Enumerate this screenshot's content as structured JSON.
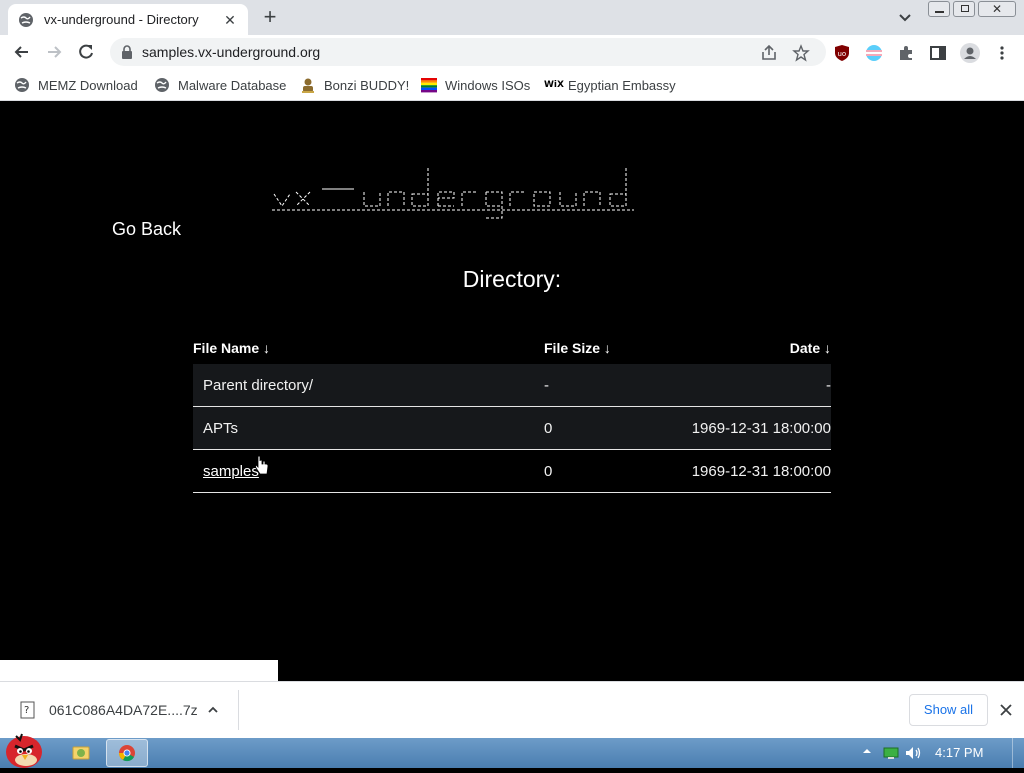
{
  "browser": {
    "tab_title": "vx-underground - Directory",
    "url": "samples.vx-underground.org",
    "bookmarks": [
      {
        "label": "MEMZ Download",
        "icon": "globe-icon"
      },
      {
        "label": "Malware Database",
        "icon": "globe-icon"
      },
      {
        "label": "Bonzi BUDDY!",
        "icon": "bonzi-icon"
      },
      {
        "label": "Windows ISOs",
        "icon": "rainbow-flag-icon"
      },
      {
        "label": "Egyptian Embassy",
        "icon": "wix-icon"
      }
    ]
  },
  "page": {
    "logo_text": "vx-underground",
    "go_back": "Go Back",
    "directory_title": "Directory:",
    "columns": {
      "name": "File Name  ↓",
      "size": "File Size  ↓",
      "date": "Date  ↓"
    },
    "rows": [
      {
        "name": "Parent directory/",
        "size": "-",
        "date": "-",
        "link": false
      },
      {
        "name": "APTs",
        "size": "0",
        "date": "1969-12-31 18:00:00",
        "link": false
      },
      {
        "name": "samples",
        "size": "0",
        "date": "1969-12-31 18:00:00",
        "link": true
      }
    ]
  },
  "downloads": {
    "file_name": "061C086A4DA72E....7z",
    "show_all": "Show all"
  },
  "taskbar": {
    "clock": "4:17 PM"
  },
  "colors": {
    "page_bg": "#000000",
    "tabstrip_bg": "#dee1e6",
    "link_blue": "#1a73e8",
    "taskbar": "#5b8cbd"
  }
}
